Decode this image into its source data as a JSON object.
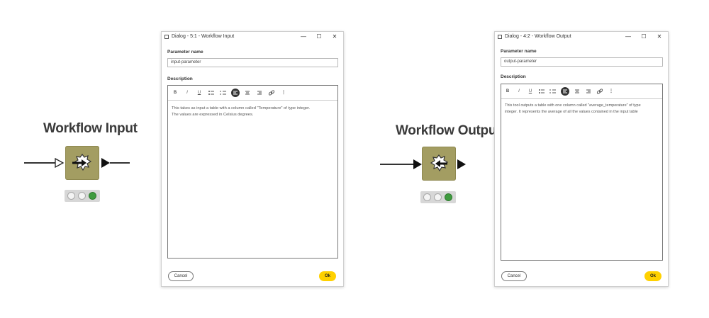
{
  "nodes": {
    "input": {
      "title": "Workflow Input"
    },
    "output": {
      "title": "Workflow Output"
    }
  },
  "colors": {
    "node_fill": "#a39d62",
    "status_green": "#3f9b3f",
    "ok_button": "#ffd100"
  },
  "dialog_input": {
    "title": "Dialog - 5:1 - Workflow Input",
    "param_label": "Parameter name",
    "param_value": "input-parameter",
    "description_label": "Description",
    "description_line1": "This takes as input a table with a column called \"Temperature\" of type integer.",
    "description_line2": "The values are expressed in Celsius degrees.",
    "cancel_label": "Cancel",
    "ok_label": "Ok"
  },
  "dialog_output": {
    "title": "Dialog - 4:2 - Workflow Output",
    "param_label": "Parameter name",
    "param_value": "output-parameter",
    "description_label": "Description",
    "description_line1": "This tool outputs a table with one column called \"average_temperature\" of type",
    "description_line2": "integer. It represents the average of all the values contained in the input table",
    "cancel_label": "Cancel",
    "ok_label": "Ok"
  },
  "toolbar": {
    "bold": "B",
    "italic": "I",
    "underline": "U",
    "more": "⋮"
  },
  "window_controls": {
    "minimize": "—",
    "maximize": "☐",
    "close": "✕"
  }
}
